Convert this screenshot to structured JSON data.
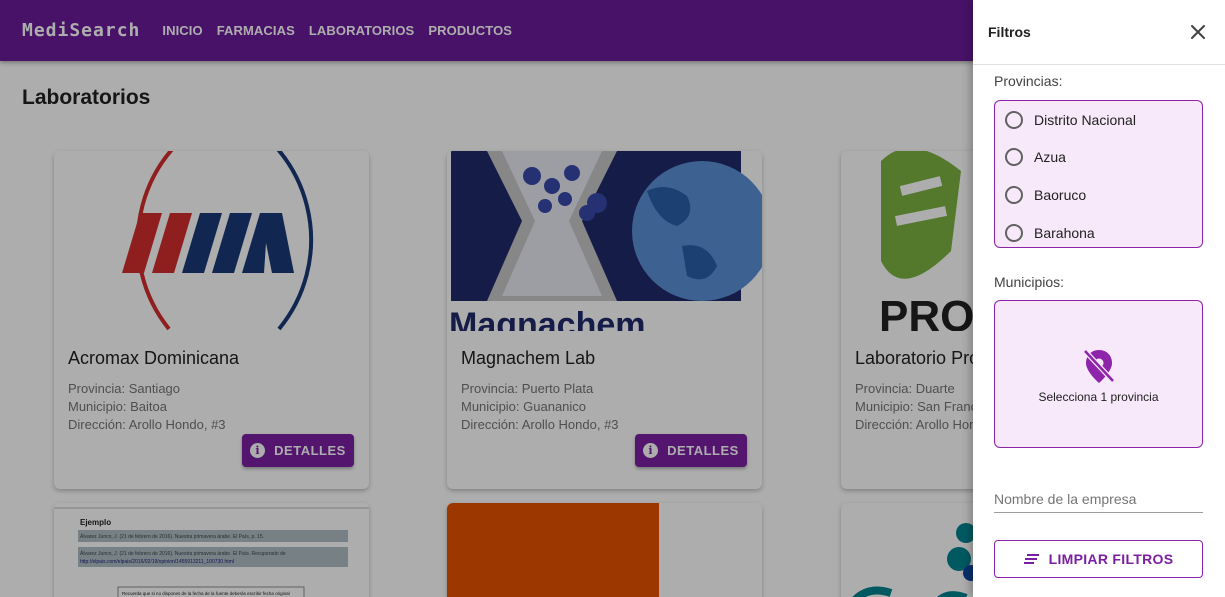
{
  "brand": "MediSearch",
  "nav": [
    "INICIO",
    "FARMACIAS",
    "LABORATORIOS",
    "PRODUCTOS"
  ],
  "page_title": "Laboratorios",
  "cards": [
    {
      "name": "Acromax Dominicana",
      "provincia": "Provincia: Santiago",
      "municipio": "Municipio: Baitoa",
      "direccion": "Dirección: Arollo Hondo, #3",
      "button": "DETALLES"
    },
    {
      "name": "Magnachem Lab",
      "provincia": "Provincia: Puerto Plata",
      "municipio": "Municipio: Guananico",
      "direccion": "Dirección: Arollo Hondo, #3",
      "button": "DETALLES"
    },
    {
      "name": "Laboratorio Pro",
      "provincia": "Provincia: Duarte",
      "municipio": "Municipio: San Franc",
      "direccion": "Dirección: Arollo Hon"
    }
  ],
  "logo_texts": {
    "magnachem": "Magnachem",
    "pro": "PROF"
  },
  "card_bottom": {
    "doc_heading": "Ejemplo",
    "doc_line1": "Álvarez Junco, J. (21 de febrero de 2016). Nuestra primavera árabe. El País, p. 15.",
    "doc_line2": "Álvarez Junco, J. (21 de febrero de 2016). Nuestra primavera árabe. El País. Recuperado de",
    "doc_line3": "http://elpais.com/elpais/2016/02/19/opinion/1455913211_100730.html",
    "doc_line4": "Recuerda que si no dispones de la fecha de la fuente deberás escribir fecha original"
  },
  "drawer": {
    "title": "Filtros",
    "provincias_label": "Provincias:",
    "provincias": [
      "Distrito Nacional",
      "Azua",
      "Baoruco",
      "Barahona"
    ],
    "municipios_label": "Municipios:",
    "municipios_empty": "Selecciona 1 provincia",
    "name_placeholder": "Nombre de la empresa",
    "clear_button": "LIMPIAR FILTROS"
  },
  "colors": {
    "primary": "#6a1b9a",
    "button": "#7b1fa2",
    "accent_border": "#8e24aa",
    "box_bg": "#f7e9fa"
  },
  "icons": {
    "info": "info-icon",
    "close": "close-icon",
    "location_off": "location-off-icon",
    "filter": "filter-list-icon"
  }
}
